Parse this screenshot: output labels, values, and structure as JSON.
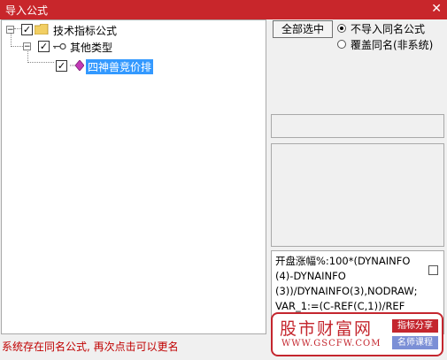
{
  "window": {
    "title": "导入公式",
    "close_glyph": "✕"
  },
  "tree": {
    "root": {
      "label": "技术指标公式",
      "expander": "−",
      "checked": "✓"
    },
    "child": {
      "label": "其他类型",
      "expander": "−",
      "checked": "✓"
    },
    "leaf": {
      "label": "四神兽竞价排",
      "checked": "✓"
    }
  },
  "buttons": {
    "select_all": "全部选中"
  },
  "options": {
    "no_import_same_name": "不导入同名公式",
    "overwrite_same_name": "覆盖同名(非系统)"
  },
  "formula": {
    "line1": "开盘涨幅%:100*(DYNAINFO",
    "line2": "(4)-DYNAINFO",
    "line3": "(3))/DYNAINFO(3),NODRAW;",
    "line4": "VAR_1:=(C-REF(C,1))/REF"
  },
  "status": "系统存在同名公式, 再次点击可以更名",
  "watermark": {
    "title": "股市财富网",
    "url": "WWW.GSCFW.COM",
    "tag1": "指标分享",
    "tag2": "名师课程"
  },
  "colors": {
    "title_bar": "#c8262b",
    "selection": "#3399ff",
    "status_text": "#c00000"
  },
  "icons": [
    "folder-icon",
    "key-icon",
    "formula-icon",
    "close-icon"
  ]
}
